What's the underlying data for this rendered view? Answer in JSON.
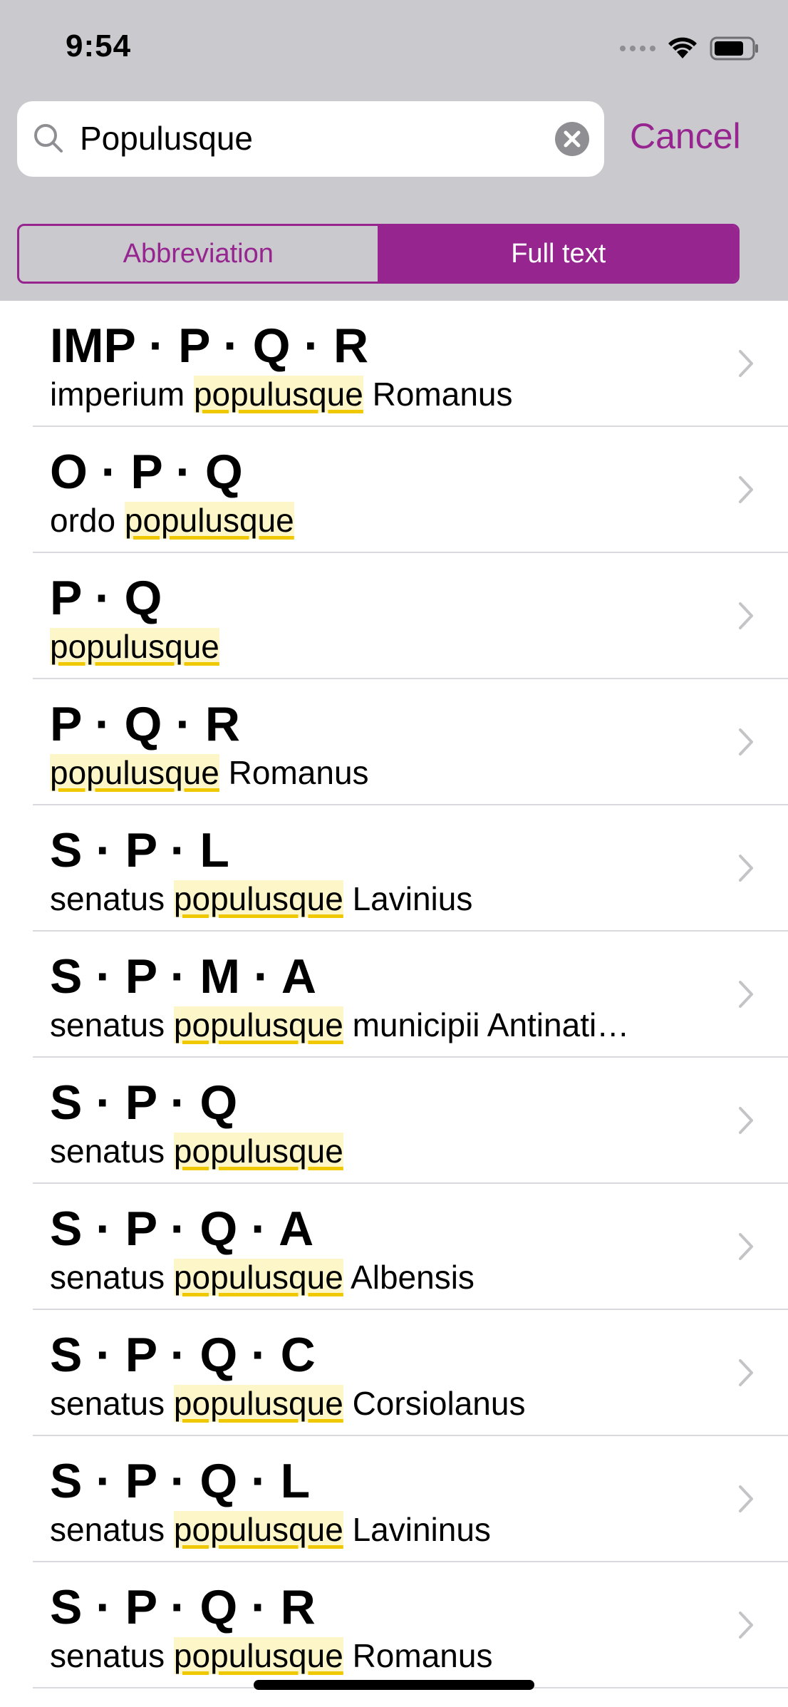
{
  "status": {
    "time": "9:54"
  },
  "search": {
    "value": "Populusque",
    "cancel_label": "Cancel"
  },
  "segments": {
    "abbreviation": "Abbreviation",
    "full_text": "Full text",
    "selected": "Full text"
  },
  "colors": {
    "accent": "#96258f",
    "highlight": "#fcf6c9",
    "highlight_underline": "#f0c800"
  },
  "results": [
    {
      "abbr": "IMP · P · Q · R",
      "before": "imperium ",
      "match": "populusque",
      "after": " Romanus"
    },
    {
      "abbr": "O · P · Q",
      "before": "ordo ",
      "match": "populusque",
      "after": ""
    },
    {
      "abbr": "P · Q",
      "before": "",
      "match": "populusque",
      "after": ""
    },
    {
      "abbr": "P · Q · R",
      "before": "",
      "match": "populusque",
      "after": " Romanus"
    },
    {
      "abbr": "S · P · L",
      "before": "senatus ",
      "match": "populusque",
      "after": " Lavinius"
    },
    {
      "abbr": "S · P · M · A",
      "before": "senatus ",
      "match": "populusque",
      "after": " municipii Antinati…"
    },
    {
      "abbr": "S · P · Q",
      "before": "senatus ",
      "match": "populusque",
      "after": ""
    },
    {
      "abbr": "S · P · Q · A",
      "before": "senatus ",
      "match": "populusque",
      "after": " Albensis"
    },
    {
      "abbr": "S · P · Q · C",
      "before": "senatus ",
      "match": "populusque",
      "after": " Corsiolanus"
    },
    {
      "abbr": "S · P · Q · L",
      "before": "senatus ",
      "match": "populusque",
      "after": " Lavininus"
    },
    {
      "abbr": "S · P · Q · R",
      "before": "senatus ",
      "match": "populusque",
      "after": " Romanus"
    }
  ]
}
